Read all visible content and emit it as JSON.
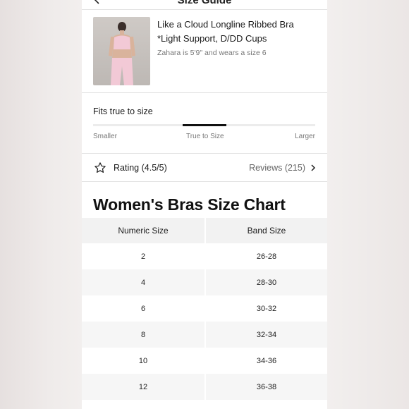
{
  "header": {
    "title": "Size Guide"
  },
  "product": {
    "name": "Like a Cloud Longline Ribbed Bra *Light Support, D/DD Cups",
    "model_info": "Zahara is 5'9\" and wears a size 6"
  },
  "fit": {
    "title": "Fits true to size",
    "labels": {
      "smaller": "Smaller",
      "true_to_size": "True to Size",
      "larger": "Larger"
    },
    "position": 0.5
  },
  "rating": {
    "label": "Rating (4.5/5)",
    "reviews": "Reviews (215)"
  },
  "chart": {
    "title": "Women's Bras Size Chart",
    "columns": [
      "Numeric Size",
      "Band Size"
    ],
    "rows": [
      [
        "2",
        "26-28"
      ],
      [
        "4",
        "28-30"
      ],
      [
        "6",
        "30-32"
      ],
      [
        "8",
        "32-34"
      ],
      [
        "10",
        "34-36"
      ],
      [
        "12",
        "36-38"
      ]
    ]
  },
  "colors": {
    "accent": "#111111",
    "header_row": "#f2f2f2",
    "stripe_row": "#f6f6f6",
    "product_pink": "#f2c9d6"
  },
  "icons": [
    "back-arrow-icon",
    "star-icon",
    "chevron-right-icon"
  ]
}
